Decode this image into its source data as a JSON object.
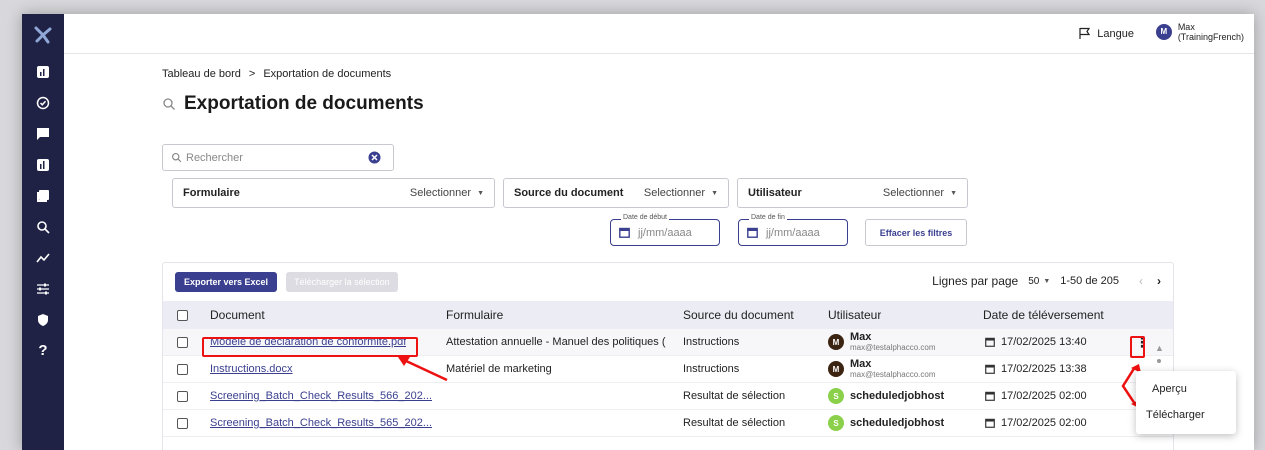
{
  "topbar": {
    "language_label": "Langue",
    "user_initial": "M",
    "user_name": "Max",
    "user_org": "(TrainingFrench)"
  },
  "breadcrumb": {
    "home": "Tableau de bord",
    "separator": ">",
    "current": "Exportation de documents"
  },
  "page": {
    "title": "Exportation de documents"
  },
  "filters": {
    "search_placeholder": "Rechercher",
    "form_label": "Formulaire",
    "form_value": "Selectionner",
    "source_label": "Source du document",
    "source_value": "Selectionner",
    "user_label": "Utilisateur",
    "user_value": "Selectionner",
    "start_date_label": "Date de début",
    "start_date_placeholder": "jj/mm/aaaa",
    "end_date_label": "Date de fin",
    "end_date_placeholder": "jj/mm/aaaa",
    "clear_label": "Effacer les filtres"
  },
  "toolbar": {
    "export_label": "Exporter vers Excel",
    "download_selection_label": "Télécharger la sélection",
    "rows_per_page_label": "Lignes par page",
    "rows_per_page_value": "50",
    "range_label": "1-50 de 205"
  },
  "table": {
    "headers": [
      "Document",
      "Formulaire",
      "Source du document",
      "Utilisateur",
      "Date de téléversement"
    ],
    "rows": [
      {
        "document": "Modèle de déclaration de conformité.pdf",
        "form": "Attestation annuelle - Manuel des politiques (",
        "source": "Instructions",
        "user_initial": "M",
        "user_name": "Max",
        "user_email": "max@testalphacco.com",
        "date": "17/02/2025 13:40"
      },
      {
        "document": "Instructions.docx",
        "form": "Matériel de marketing",
        "source": "Instructions",
        "user_initial": "M",
        "user_name": "Max",
        "user_email": "max@testalphacco.com",
        "date": "17/02/2025 13:38"
      },
      {
        "document": "Screening_Batch_Check_Results_566_202...",
        "form": "",
        "source": "Resultat de sélection",
        "user_initial": "S",
        "user_name": "scheduledjobhost",
        "user_email": "",
        "date": "17/02/2025 02:00"
      },
      {
        "document": "Screening_Batch_Check_Results_565_202...",
        "form": "",
        "source": "Resultat de sélection",
        "user_initial": "S",
        "user_name": "scheduledjobhost",
        "user_email": "",
        "date": "17/02/2025 02:00"
      }
    ]
  },
  "row_menu": {
    "preview_label": "Aperçu",
    "download_label": "Télécharger"
  },
  "colors": {
    "sidebar": "#1f2245",
    "accent": "#3a3f8f",
    "annotation": "#e11111",
    "avatar_max": "#3b2412",
    "avatar_s": "#8bd04a"
  }
}
